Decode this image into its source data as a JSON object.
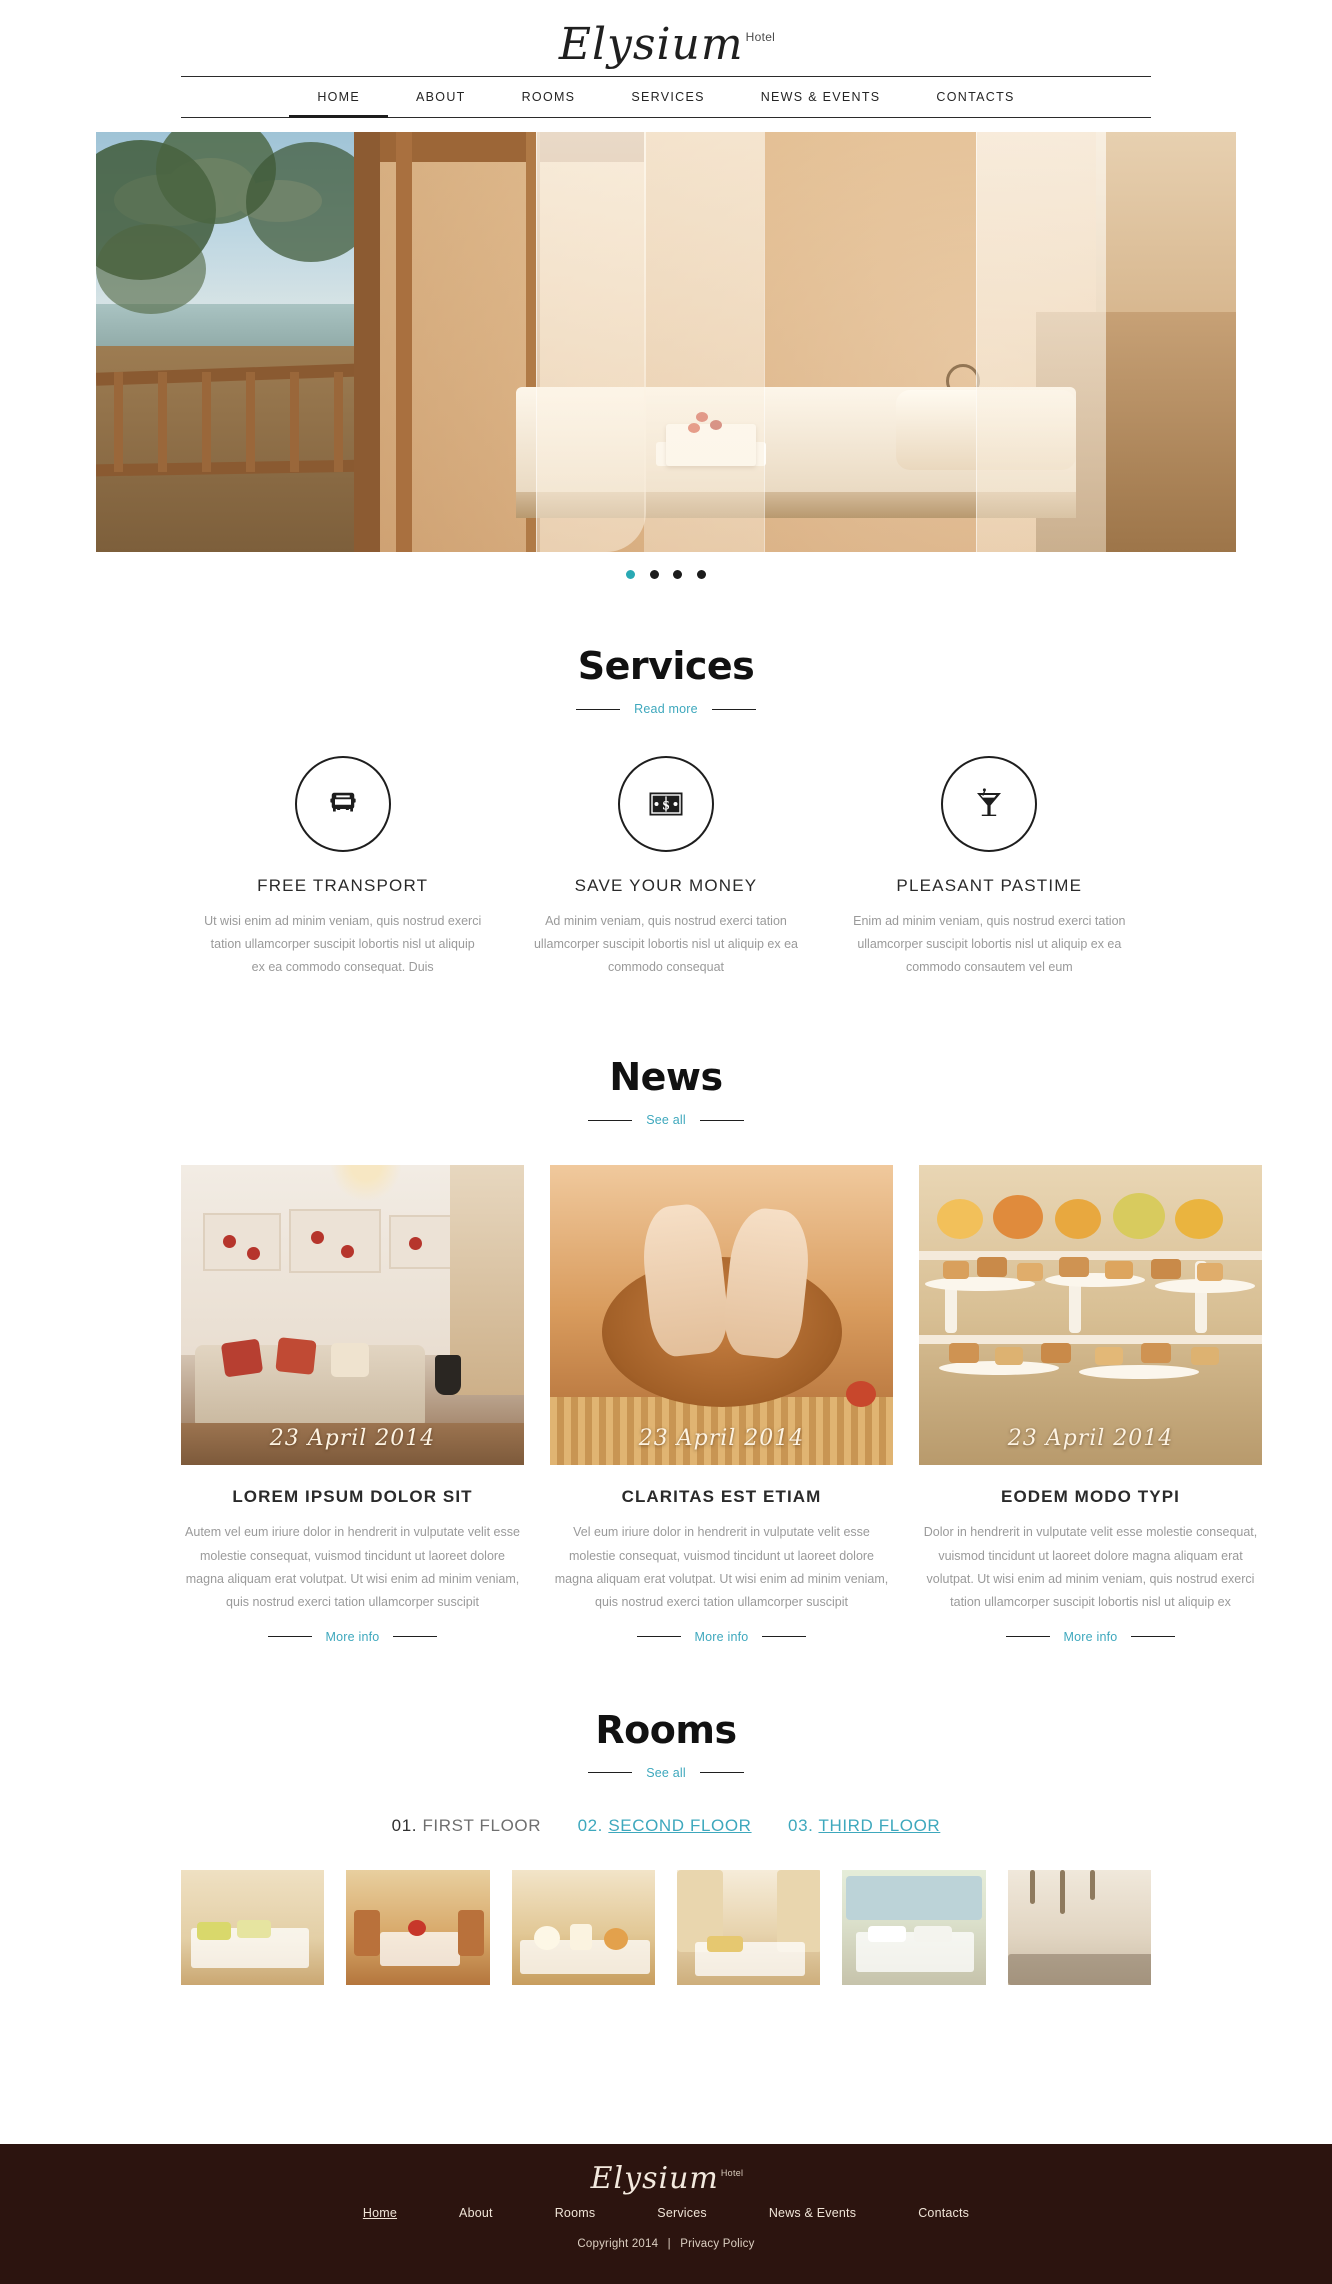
{
  "brand": {
    "name": "Elysium",
    "suffix": "Hotel"
  },
  "nav": {
    "items": [
      {
        "label": "HOME",
        "active": true
      },
      {
        "label": "ABOUT",
        "active": false
      },
      {
        "label": "ROOMS",
        "active": false
      },
      {
        "label": "SERVICES",
        "active": false
      },
      {
        "label": "NEWS & EVENTS",
        "active": false
      },
      {
        "label": "CONTACTS",
        "active": false
      }
    ]
  },
  "slider": {
    "dot_count": 4,
    "active_index": 0,
    "active_color": "#29a9b4",
    "inactive_color": "#1c1c1c"
  },
  "services": {
    "heading": "Services",
    "link": "Read more",
    "items": [
      {
        "icon": "bus-icon",
        "title": "FREE TRANSPORT",
        "text": "Ut wisi enim ad minim veniam, quis nostrud exerci tation ullamcorper suscipit lobortis nisl ut aliquip ex ea commodo consequat. Duis"
      },
      {
        "icon": "banknote-icon",
        "title": "SAVE YOUR MONEY",
        "text": "Ad minim veniam, quis nostrud exerci tation ullamcorper suscipit lobortis nisl ut aliquip ex ea commodo consequat"
      },
      {
        "icon": "cocktail-icon",
        "title": "PLEASANT PASTIME",
        "text": "Enim ad minim veniam, quis nostrud exerci tation ullamcorper suscipit lobortis nisl ut aliquip ex ea commodo consautem vel eum"
      }
    ]
  },
  "news": {
    "heading": "News",
    "link": "See all",
    "more_label": "More info",
    "items": [
      {
        "date": "23 April 2014",
        "title": "LOREM IPSUM DOLOR SIT",
        "text": "Autem vel eum iriure dolor in hendrerit in vulputate velit esse molestie consequat, vuismod tincidunt ut laoreet dolore magna aliquam erat volutpat. Ut wisi enim ad minim veniam, quis nostrud exerci tation ullamcorper suscipit"
      },
      {
        "date": "23 April 2014",
        "title": "CLARITAS EST ETIAM",
        "text": "Vel eum iriure dolor in hendrerit in vulputate velit esse molestie consequat, vuismod tincidunt ut laoreet dolore magna aliquam erat volutpat. Ut wisi enim ad minim veniam, quis nostrud exerci tation ullamcorper suscipit"
      },
      {
        "date": "23 April 2014",
        "title": "EODEM MODO TYPI",
        "text": "Dolor in hendrerit in vulputate velit esse molestie consequat, vuismod tincidunt ut laoreet dolore magna aliquam erat volutpat. Ut wisi enim ad minim veniam, quis nostrud exerci tation ullamcorper suscipit lobortis nisl ut aliquip ex"
      }
    ]
  },
  "rooms": {
    "heading": "Rooms",
    "link": "See all",
    "floors": [
      {
        "num": "01.",
        "name": "FIRST FLOOR",
        "active": true
      },
      {
        "num": "02.",
        "name": "SECOND FLOOR",
        "active": false
      },
      {
        "num": "03.",
        "name": "THIRD FLOOR",
        "active": false
      }
    ],
    "thumb_count": 6
  },
  "footer": {
    "brand": {
      "name": "Elysium",
      "suffix": "Hotel"
    },
    "nav": [
      {
        "label": "Home",
        "active": true
      },
      {
        "label": "About",
        "active": false
      },
      {
        "label": "Rooms",
        "active": false
      },
      {
        "label": "Services",
        "active": false
      },
      {
        "label": "News & Events",
        "active": false
      },
      {
        "label": "Contacts",
        "active": false
      }
    ],
    "copyright": "Copyright 2014",
    "separator": "|",
    "privacy": "Privacy Policy",
    "background": "#2c140f"
  },
  "accent_color": "#3ea8bd"
}
